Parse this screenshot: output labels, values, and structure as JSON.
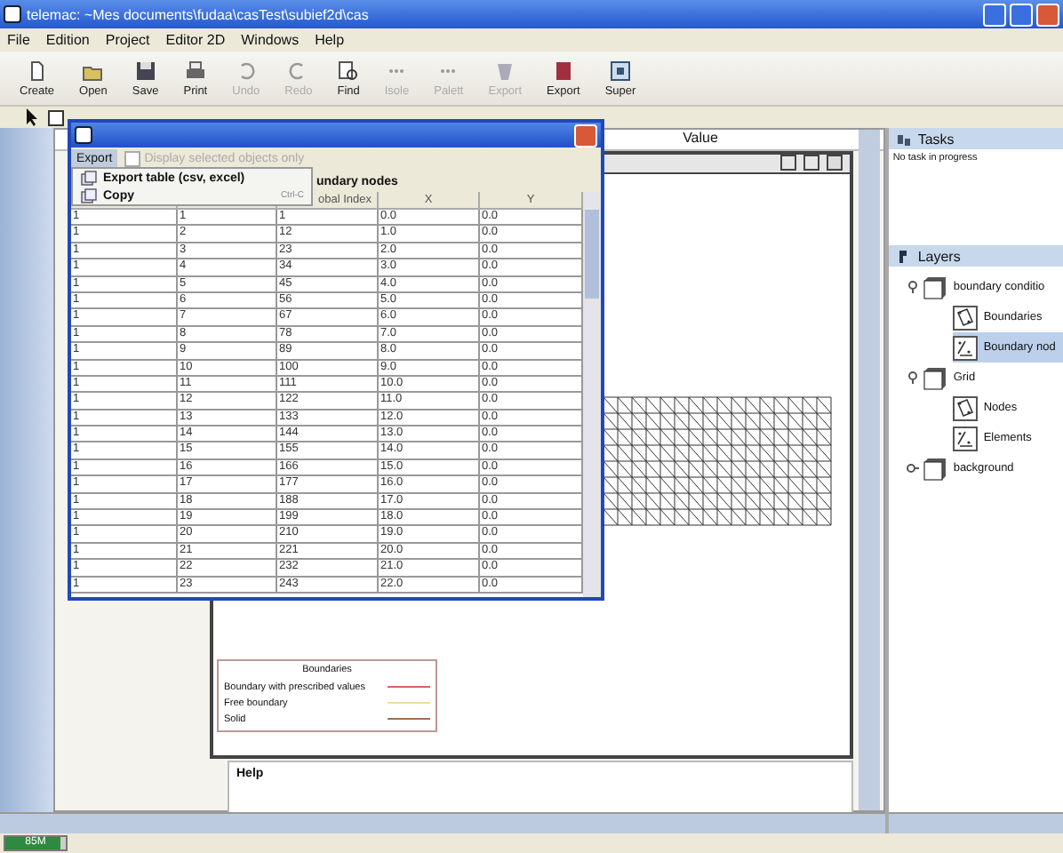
{
  "window": {
    "title": "telemac: ~Mes documents\\fudaa\\casTest\\subief2d\\cas"
  },
  "menu": [
    {
      "label": "File"
    },
    {
      "label": "Edition"
    },
    {
      "label": "Project"
    },
    {
      "label": "Editor 2D"
    },
    {
      "label": "Windows"
    },
    {
      "label": "Help"
    }
  ],
  "toolbar": [
    {
      "label": "Create",
      "disabled": false
    },
    {
      "label": "Open",
      "disabled": false
    },
    {
      "label": "Save",
      "disabled": false
    },
    {
      "label": "Print",
      "disabled": false
    },
    {
      "label": "Undo",
      "disabled": true
    },
    {
      "label": "Redo",
      "disabled": true
    },
    {
      "label": "Find",
      "disabled": false
    },
    {
      "label": "Isole",
      "disabled": true
    },
    {
      "label": "Palett",
      "disabled": true
    },
    {
      "label": "Export",
      "disabled": true
    },
    {
      "label": "Export",
      "disabled": false
    },
    {
      "label": "Super",
      "disabled": false
    }
  ],
  "properties": {
    "column_2": "Value"
  },
  "canvas_frame": {
    "legend": {
      "title": "Boundaries",
      "items": [
        {
          "label": "Boundary with prescribed values",
          "color": "#e06060"
        },
        {
          "label": "Free boundary",
          "color": "#e8e0a0"
        },
        {
          "label": "Solid",
          "color": "#a07050"
        }
      ]
    }
  },
  "help_panel": {
    "title": "Help"
  },
  "tasks": {
    "title": "Tasks",
    "message": "No task in progress"
  },
  "layers": {
    "title": "Layers",
    "tree": [
      {
        "label": "boundary conditio",
        "expanded": true,
        "selected": false,
        "children": [
          {
            "label": "Boundaries",
            "selected": false
          },
          {
            "label": "Boundary nod",
            "selected": true
          }
        ]
      },
      {
        "label": "Grid",
        "expanded": true,
        "selected": false,
        "children": [
          {
            "label": "Nodes",
            "selected": false
          },
          {
            "label": "Elements",
            "selected": false
          }
        ]
      },
      {
        "label": "background",
        "expanded": false,
        "selected": false
      }
    ]
  },
  "dialog": {
    "menu": [
      {
        "label": "Export",
        "selected": true
      }
    ],
    "checkbox": {
      "label": "Display selected objects only",
      "checked": false,
      "disabled": true
    },
    "popup": [
      {
        "label": "Export table (csv, excel)"
      },
      {
        "label": "Copy",
        "shortcut": "Ctrl-C"
      }
    ],
    "table": {
      "title": "undary nodes",
      "columns": [
        "",
        "",
        "obal Index",
        "X",
        "Y"
      ],
      "rows": [
        [
          "1",
          "1",
          "1",
          "0.0",
          "0.0"
        ],
        [
          "1",
          "2",
          "12",
          "1.0",
          "0.0"
        ],
        [
          "1",
          "3",
          "23",
          "2.0",
          "0.0"
        ],
        [
          "1",
          "4",
          "34",
          "3.0",
          "0.0"
        ],
        [
          "1",
          "5",
          "45",
          "4.0",
          "0.0"
        ],
        [
          "1",
          "6",
          "56",
          "5.0",
          "0.0"
        ],
        [
          "1",
          "7",
          "67",
          "6.0",
          "0.0"
        ],
        [
          "1",
          "8",
          "78",
          "7.0",
          "0.0"
        ],
        [
          "1",
          "9",
          "89",
          "8.0",
          "0.0"
        ],
        [
          "1",
          "10",
          "100",
          "9.0",
          "0.0"
        ],
        [
          "1",
          "11",
          "111",
          "10.0",
          "0.0"
        ],
        [
          "1",
          "12",
          "122",
          "11.0",
          "0.0"
        ],
        [
          "1",
          "13",
          "133",
          "12.0",
          "0.0"
        ],
        [
          "1",
          "14",
          "144",
          "13.0",
          "0.0"
        ],
        [
          "1",
          "15",
          "155",
          "14.0",
          "0.0"
        ],
        [
          "1",
          "16",
          "166",
          "15.0",
          "0.0"
        ],
        [
          "1",
          "17",
          "177",
          "16.0",
          "0.0"
        ],
        [
          "1",
          "18",
          "188",
          "17.0",
          "0.0"
        ],
        [
          "1",
          "19",
          "199",
          "18.0",
          "0.0"
        ],
        [
          "1",
          "20",
          "210",
          "19.0",
          "0.0"
        ],
        [
          "1",
          "21",
          "221",
          "20.0",
          "0.0"
        ],
        [
          "1",
          "22",
          "232",
          "21.0",
          "0.0"
        ],
        [
          "1",
          "23",
          "243",
          "22.0",
          "0.0"
        ]
      ]
    }
  },
  "status_bar": {
    "memory": {
      "reading": "85M",
      "level": 0.9
    }
  }
}
